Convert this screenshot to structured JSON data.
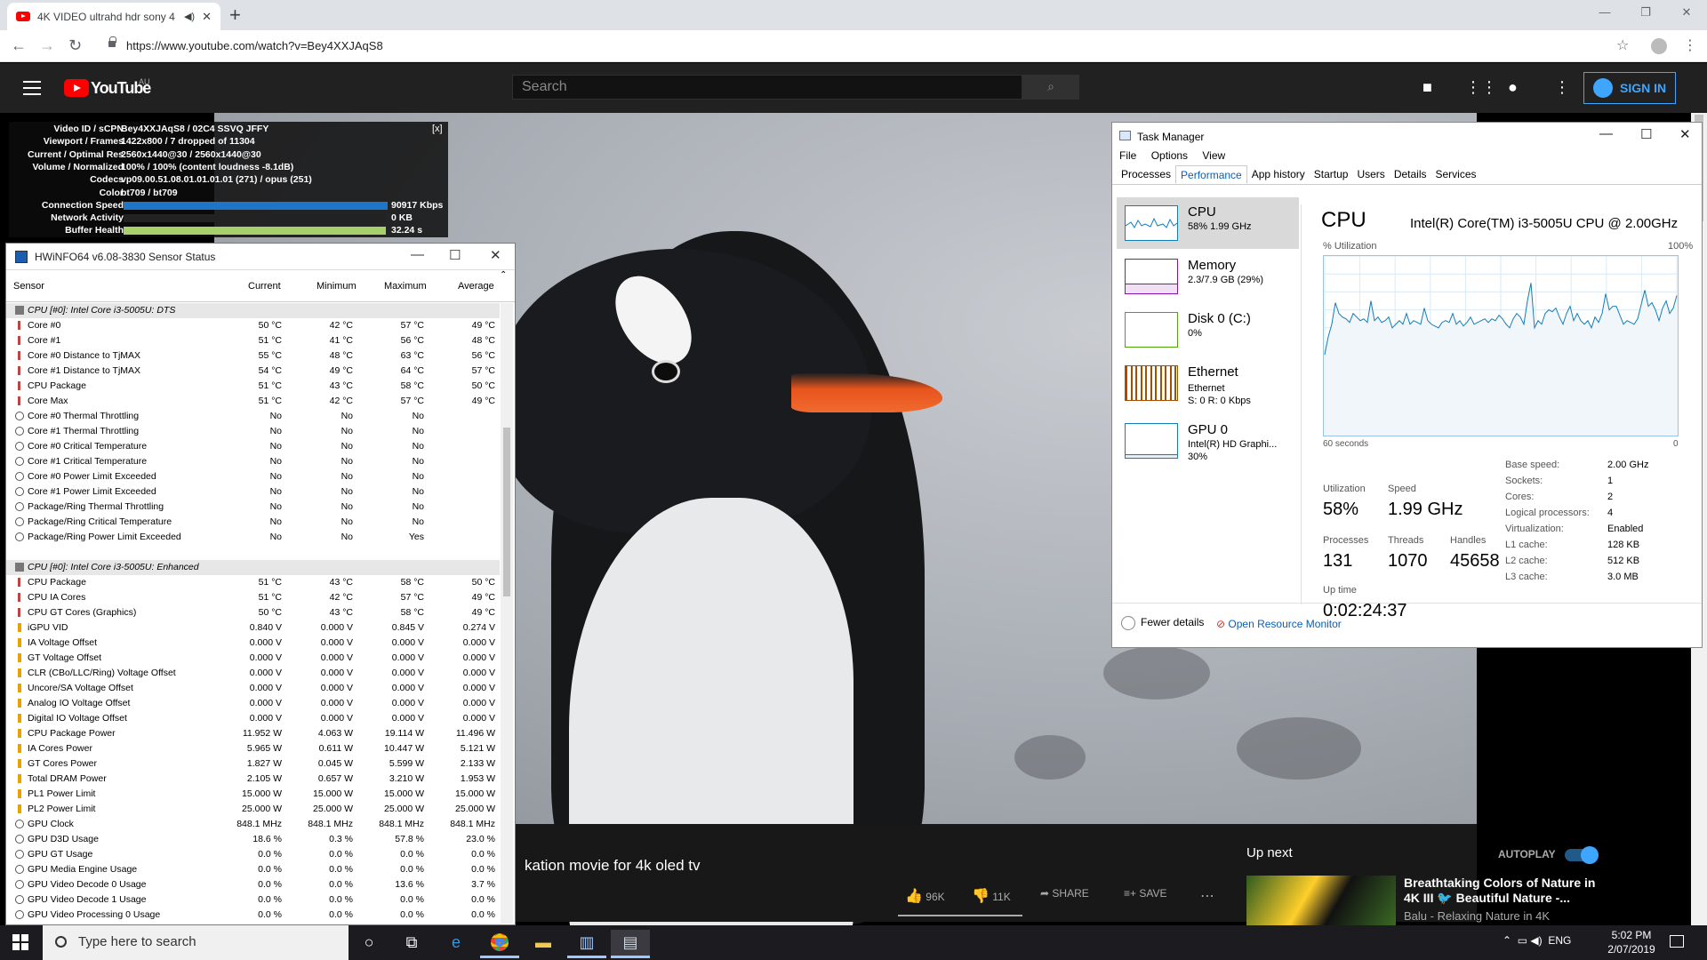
{
  "browser": {
    "tab_title": "4K VIDEO ultrahd hdr sony 4",
    "url": "https://www.youtube.com/watch?v=Bey4XXJAqS8"
  },
  "youtube": {
    "logo": "YouTube",
    "region": "AU",
    "search_placeholder": "Search",
    "sign_in": "SIGN IN",
    "video_title": "kation movie for 4k oled tv",
    "likes": "96K",
    "dislikes": "11K",
    "share": "SHARE",
    "save": "SAVE",
    "up_next": "Up next",
    "autoplay": "AUTOPLAY",
    "next_title": "Breathtaking Colors of Nature in 4K III 🐦 Beautiful Nature -...",
    "next_channel": "Balu - Relaxing Nature in 4K"
  },
  "stats": {
    "close": "[x]",
    "rows": [
      {
        "k": "Video ID / sCPN",
        "v": "Bey4XXJAqS8 / 02C4 SSVQ JFFY"
      },
      {
        "k": "Viewport / Frames",
        "v": "1422x800 / 7 dropped of 11304"
      },
      {
        "k": "Current / Optimal Res",
        "v": "2560x1440@30 / 2560x1440@30"
      },
      {
        "k": "Volume / Normalized",
        "v": "100% / 100% (content loudness -8.1dB)"
      },
      {
        "k": "Codecs",
        "v": "vp09.00.51.08.01.01.01.01 (271) / opus (251)"
      },
      {
        "k": "Color",
        "v": "bt709 / bt709"
      },
      {
        "k": "Connection Speed",
        "v": "90917 Kbps"
      },
      {
        "k": "Network Activity",
        "v": "0 KB"
      },
      {
        "k": "Buffer Health",
        "v": "32.24 s"
      }
    ]
  },
  "hwinfo": {
    "title": "HWiNFO64 v6.08-3830 Sensor Status",
    "cols": [
      "Sensor",
      "Current",
      "Minimum",
      "Maximum",
      "Average"
    ],
    "rows": [
      {
        "g": "CPU [#0]: Intel Core i3-5005U: DTS"
      },
      {
        "i": "t",
        "n": "Core #0",
        "c": "50 °C",
        "mn": "42 °C",
        "mx": "57 °C",
        "a": "49 °C"
      },
      {
        "i": "t",
        "n": "Core #1",
        "c": "51 °C",
        "mn": "41 °C",
        "mx": "56 °C",
        "a": "48 °C"
      },
      {
        "i": "t",
        "n": "Core #0 Distance to TjMAX",
        "c": "55 °C",
        "mn": "48 °C",
        "mx": "63 °C",
        "a": "56 °C"
      },
      {
        "i": "t",
        "n": "Core #1 Distance to TjMAX",
        "c": "54 °C",
        "mn": "49 °C",
        "mx": "64 °C",
        "a": "57 °C"
      },
      {
        "i": "t",
        "n": "CPU Package",
        "c": "51 °C",
        "mn": "43 °C",
        "mx": "58 °C",
        "a": "50 °C"
      },
      {
        "i": "t",
        "n": "Core Max",
        "c": "51 °C",
        "mn": "42 °C",
        "mx": "57 °C",
        "a": "49 °C"
      },
      {
        "i": "o",
        "n": "Core #0 Thermal Throttling",
        "c": "No",
        "mn": "No",
        "mx": "No",
        "a": ""
      },
      {
        "i": "o",
        "n": "Core #1 Thermal Throttling",
        "c": "No",
        "mn": "No",
        "mx": "No",
        "a": ""
      },
      {
        "i": "o",
        "n": "Core #0 Critical Temperature",
        "c": "No",
        "mn": "No",
        "mx": "No",
        "a": ""
      },
      {
        "i": "o",
        "n": "Core #1 Critical Temperature",
        "c": "No",
        "mn": "No",
        "mx": "No",
        "a": ""
      },
      {
        "i": "o",
        "n": "Core #0 Power Limit Exceeded",
        "c": "No",
        "mn": "No",
        "mx": "No",
        "a": ""
      },
      {
        "i": "o",
        "n": "Core #1 Power Limit Exceeded",
        "c": "No",
        "mn": "No",
        "mx": "No",
        "a": ""
      },
      {
        "i": "o",
        "n": "Package/Ring Thermal Throttling",
        "c": "No",
        "mn": "No",
        "mx": "No",
        "a": ""
      },
      {
        "i": "o",
        "n": "Package/Ring Critical Temperature",
        "c": "No",
        "mn": "No",
        "mx": "No",
        "a": ""
      },
      {
        "i": "o",
        "n": "Package/Ring Power Limit Exceeded",
        "c": "No",
        "mn": "No",
        "mx": "Yes",
        "a": ""
      },
      {
        "blank": true
      },
      {
        "g": "CPU [#0]: Intel Core i3-5005U: Enhanced"
      },
      {
        "i": "t",
        "n": "CPU Package",
        "c": "51 °C",
        "mn": "43 °C",
        "mx": "58 °C",
        "a": "50 °C"
      },
      {
        "i": "t",
        "n": "CPU IA Cores",
        "c": "51 °C",
        "mn": "42 °C",
        "mx": "57 °C",
        "a": "49 °C"
      },
      {
        "i": "t",
        "n": "CPU GT Cores (Graphics)",
        "c": "50 °C",
        "mn": "43 °C",
        "mx": "58 °C",
        "a": "49 °C"
      },
      {
        "i": "v",
        "n": "iGPU VID",
        "c": "0.840 V",
        "mn": "0.000 V",
        "mx": "0.845 V",
        "a": "0.274 V"
      },
      {
        "i": "v",
        "n": "IA Voltage Offset",
        "c": "0.000 V",
        "mn": "0.000 V",
        "mx": "0.000 V",
        "a": "0.000 V"
      },
      {
        "i": "v",
        "n": "GT Voltage Offset",
        "c": "0.000 V",
        "mn": "0.000 V",
        "mx": "0.000 V",
        "a": "0.000 V"
      },
      {
        "i": "v",
        "n": "CLR (CBo/LLC/Ring) Voltage Offset",
        "c": "0.000 V",
        "mn": "0.000 V",
        "mx": "0.000 V",
        "a": "0.000 V"
      },
      {
        "i": "v",
        "n": "Uncore/SA Voltage Offset",
        "c": "0.000 V",
        "mn": "0.000 V",
        "mx": "0.000 V",
        "a": "0.000 V"
      },
      {
        "i": "v",
        "n": "Analog IO Voltage Offset",
        "c": "0.000 V",
        "mn": "0.000 V",
        "mx": "0.000 V",
        "a": "0.000 V"
      },
      {
        "i": "v",
        "n": "Digital IO Voltage Offset",
        "c": "0.000 V",
        "mn": "0.000 V",
        "mx": "0.000 V",
        "a": "0.000 V"
      },
      {
        "i": "v",
        "n": "CPU Package Power",
        "c": "11.952 W",
        "mn": "4.063 W",
        "mx": "19.114 W",
        "a": "11.496 W"
      },
      {
        "i": "v",
        "n": "IA Cores Power",
        "c": "5.965 W",
        "mn": "0.611 W",
        "mx": "10.447 W",
        "a": "5.121 W"
      },
      {
        "i": "v",
        "n": "GT Cores Power",
        "c": "1.827 W",
        "mn": "0.045 W",
        "mx": "5.599 W",
        "a": "2.133 W"
      },
      {
        "i": "v",
        "n": "Total DRAM Power",
        "c": "2.105 W",
        "mn": "0.657 W",
        "mx": "3.210 W",
        "a": "1.953 W"
      },
      {
        "i": "v",
        "n": "PL1 Power Limit",
        "c": "15.000 W",
        "mn": "15.000 W",
        "mx": "15.000 W",
        "a": "15.000 W"
      },
      {
        "i": "v",
        "n": "PL2 Power Limit",
        "c": "25.000 W",
        "mn": "25.000 W",
        "mx": "25.000 W",
        "a": "25.000 W"
      },
      {
        "i": "o",
        "n": "GPU Clock",
        "c": "848.1 MHz",
        "mn": "848.1 MHz",
        "mx": "848.1 MHz",
        "a": "848.1 MHz"
      },
      {
        "i": "o",
        "n": "GPU D3D Usage",
        "c": "18.6 %",
        "mn": "0.3 %",
        "mx": "57.8 %",
        "a": "23.0 %"
      },
      {
        "i": "o",
        "n": "GPU GT Usage",
        "c": "0.0 %",
        "mn": "0.0 %",
        "mx": "0.0 %",
        "a": "0.0 %"
      },
      {
        "i": "o",
        "n": "GPU Media Engine Usage",
        "c": "0.0 %",
        "mn": "0.0 %",
        "mx": "0.0 %",
        "a": "0.0 %"
      },
      {
        "i": "o",
        "n": "GPU Video Decode 0 Usage",
        "c": "0.0 %",
        "mn": "0.0 %",
        "mx": "13.6 %",
        "a": "3.7 %"
      },
      {
        "i": "o",
        "n": "GPU Video Decode 1 Usage",
        "c": "0.0 %",
        "mn": "0.0 %",
        "mx": "0.0 %",
        "a": "0.0 %"
      },
      {
        "i": "o",
        "n": "GPU Video Processing 0 Usage",
        "c": "0.0 %",
        "mn": "0.0 %",
        "mx": "0.0 %",
        "a": "0.0 %"
      }
    ]
  },
  "taskmgr": {
    "title": "Task Manager",
    "menu": [
      "File",
      "Options",
      "View"
    ],
    "tabs": [
      "Processes",
      "Performance",
      "App history",
      "Startup",
      "Users",
      "Details",
      "Services"
    ],
    "side": [
      {
        "h": "CPU",
        "s1": "58% 1.99 GHz",
        "s2": "",
        "color": "#117dbb"
      },
      {
        "h": "Memory",
        "s1": "2.3/7.9 GB (29%)",
        "s2": "",
        "color": "#8b12ae"
      },
      {
        "h": "Disk 0 (C:)",
        "s1": "0%",
        "s2": "",
        "color": "#4da60c"
      },
      {
        "h": "Ethernet",
        "s1": "Ethernet",
        "s2": "S: 0 R: 0 Kbps",
        "color": "#a74f01"
      },
      {
        "h": "GPU 0",
        "s1": "Intel(R) HD Graphi...",
        "s2": "30%",
        "color": "#117dbb"
      }
    ],
    "cpu_title": "CPU",
    "cpu_name": "Intel(R) Core(TM) i3-5005U CPU @ 2.00GHz",
    "util_label": "% Utilization",
    "max_label": "100%",
    "time_label": "60 seconds",
    "zero_label": "0",
    "chart_data": {
      "type": "area",
      "x_label": "60 seconds",
      "y_label": "% Utilization",
      "ylim": [
        0,
        100
      ],
      "values": [
        45,
        55,
        62,
        74,
        68,
        66,
        65,
        63,
        68,
        66,
        64,
        65,
        63,
        75,
        64,
        66,
        63,
        64,
        66,
        60,
        62,
        64,
        62,
        68,
        62,
        64,
        63,
        62,
        71,
        64,
        62,
        61,
        60,
        63,
        64,
        63,
        68,
        62,
        64,
        61,
        63,
        66,
        62,
        63,
        64,
        65,
        63,
        65,
        64,
        67,
        65,
        62,
        60,
        65,
        68,
        66,
        62,
        75,
        85,
        60,
        64,
        62,
        68,
        70,
        69,
        71,
        66,
        62,
        68,
        72,
        64,
        68,
        64,
        62,
        64,
        60,
        66,
        63,
        68,
        79,
        70,
        72,
        72,
        67,
        62,
        64,
        63,
        62,
        65,
        73,
        81,
        72,
        74,
        70,
        64,
        71,
        75,
        68,
        71,
        78
      ]
    },
    "stats": [
      {
        "l": "Utilization",
        "v": "58%"
      },
      {
        "l": "Speed",
        "v": "1.99 GHz"
      },
      {
        "l": "Processes",
        "v": "131"
      },
      {
        "l": "Threads",
        "v": "1070"
      },
      {
        "l": "Handles",
        "v": "45658"
      },
      {
        "l": "Up time",
        "v": "0:02:24:37"
      }
    ],
    "kv": [
      {
        "k": "Base speed:",
        "v": "2.00 GHz"
      },
      {
        "k": "Sockets:",
        "v": "1"
      },
      {
        "k": "Cores:",
        "v": "2"
      },
      {
        "k": "Logical processors:",
        "v": "4"
      },
      {
        "k": "Virtualization:",
        "v": "Enabled"
      },
      {
        "k": "L1 cache:",
        "v": "128 KB"
      },
      {
        "k": "L2 cache:",
        "v": "512 KB"
      },
      {
        "k": "L3 cache:",
        "v": "3.0 MB"
      }
    ],
    "fewer": "Fewer details",
    "orm": "Open Resource Monitor"
  },
  "taskbar": {
    "search": "Type here to search",
    "lang": "ENG",
    "time": "5:02 PM",
    "date": "2/07/2019"
  }
}
